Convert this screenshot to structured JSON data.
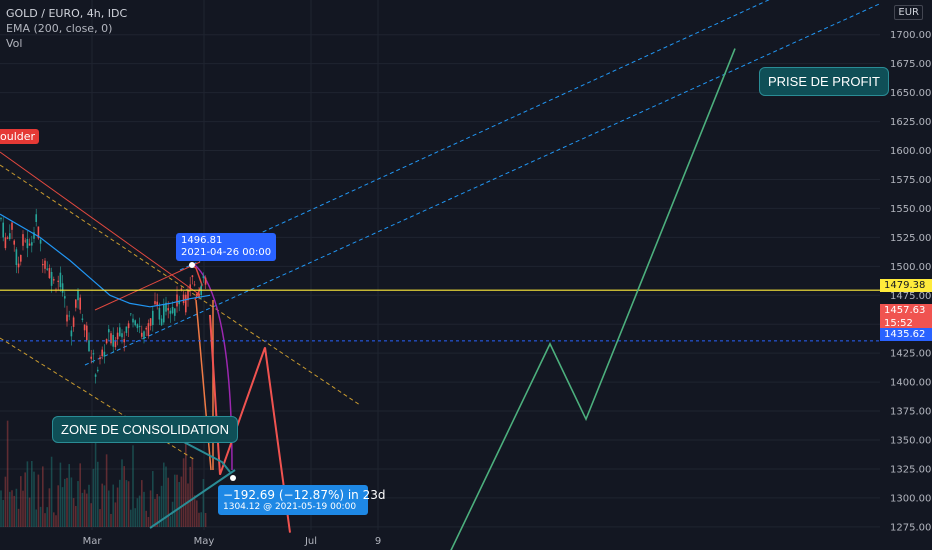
{
  "legend": {
    "symbol": "GOLD / EURO, 4h, IDC",
    "indicator": "EMA (200, close, 0)",
    "volume": "Vol"
  },
  "axis": {
    "currency": "EUR",
    "labels_dom": {
      "p1479": "1479.38",
      "p1457": "1457.63",
      "countdown": "15:52",
      "p1435": "1435.62"
    }
  },
  "annotations": {
    "shoulder_tag": "oulder",
    "take_profit": "PRISE DE PROFIT",
    "consolidation": "ZONE DE CONSOLIDATION",
    "peak_price": "1496.81",
    "peak_date": "2021-04-26  00:00",
    "measure_change": "−192.69 (−12.87%) in 23d",
    "measure_target": "1304.12 @ 2021-05-19  00:00"
  },
  "colors": {
    "background": "#131722",
    "grid": "#1f2430",
    "axis_text": "#b2b5be",
    "candle_up": "#26a69a",
    "candle_down": "#ef5350",
    "ema": "#2196f3",
    "resistance": "#ffeb3b",
    "projection": "#26a69a",
    "forecast": "#f05350",
    "last_price": "#f05350",
    "level_blue": "#2962ff",
    "callout": "#0f4f57"
  },
  "chart_data": {
    "type": "line",
    "title": "GOLD / EURO, 4h, IDC",
    "x_ticks": [
      "Mar",
      "May",
      "Jul",
      "9"
    ],
    "y_ticks": [
      1275,
      1300,
      1325,
      1350,
      1375,
      1400,
      1425,
      1450,
      1475,
      1500,
      1525,
      1550,
      1575,
      1600,
      1625,
      1650,
      1675,
      1700
    ],
    "ylim": [
      1255,
      1730
    ],
    "levels": [
      {
        "name": "resistance",
        "value": 1479.38
      },
      {
        "name": "last",
        "value": 1457.63
      },
      {
        "name": "support",
        "value": 1435.62
      }
    ],
    "price_path": {
      "t": [
        0,
        6,
        12,
        18,
        24,
        30,
        36,
        42,
        48,
        54,
        60,
        66,
        72,
        78,
        84,
        90,
        96,
        102,
        108,
        114,
        120,
        126,
        132,
        138,
        144,
        150,
        156,
        162,
        168,
        174,
        180,
        186,
        192,
        198,
        204,
        210
      ],
      "close": [
        1545,
        1520,
        1535,
        1498,
        1525,
        1515,
        1540,
        1510,
        1500,
        1485,
        1490,
        1462,
        1445,
        1475,
        1455,
        1428,
        1410,
        1420,
        1440,
        1432,
        1448,
        1440,
        1460,
        1452,
        1438,
        1450,
        1465,
        1455,
        1470,
        1462,
        1475,
        1468,
        1490,
        1478,
        1485,
        1480
      ]
    },
    "ema_200": {
      "t": [
        0,
        40,
        70,
        90,
        110,
        130,
        150,
        170,
        190,
        210
      ],
      "value": [
        1545,
        1525,
        1505,
        1490,
        1475,
        1468,
        1465,
        1468,
        1472,
        1475
      ]
    },
    "projection_path": {
      "t": [
        440,
        550,
        586,
        735
      ],
      "value": [
        1235,
        1433,
        1368,
        1688
      ]
    },
    "forecast_path": {
      "t": [
        210,
        220,
        265,
        290
      ],
      "value": [
        1458,
        1320,
        1430,
        1270
      ]
    },
    "peak": {
      "date": "2021-04-26",
      "price": 1496.81
    },
    "measure": {
      "change": -192.69,
      "percent": -12.87,
      "days": 23,
      "target": 1304.12,
      "target_date": "2021-05-19"
    }
  }
}
